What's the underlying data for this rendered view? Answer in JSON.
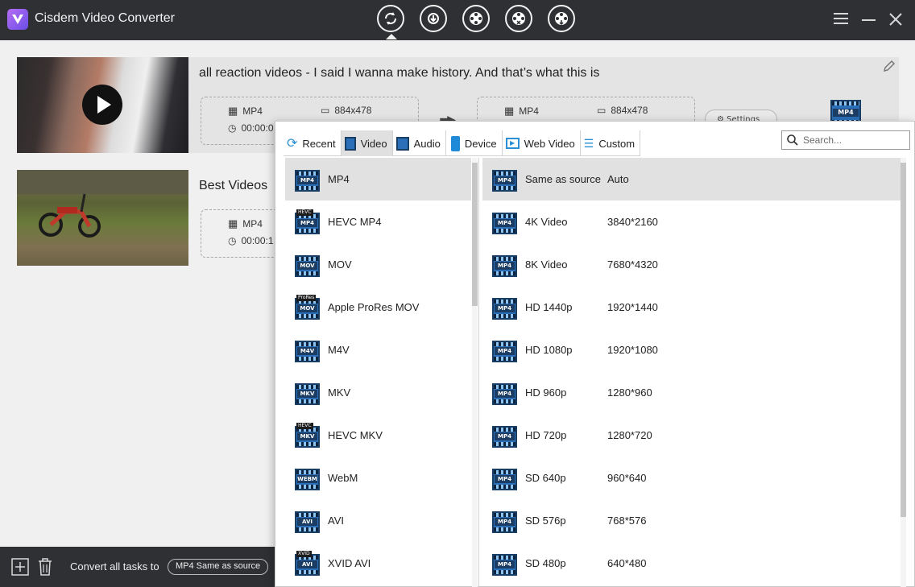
{
  "app": {
    "title": "Cisdem Video Converter"
  },
  "topnav": [
    {
      "name": "convert-tab",
      "active": true
    },
    {
      "name": "download-tab",
      "active": false
    },
    {
      "name": "burn-tab",
      "active": false
    },
    {
      "name": "rip-tab",
      "active": false
    },
    {
      "name": "compress-tab",
      "active": false
    }
  ],
  "tasks": [
    {
      "title": "all reaction videos - I said I wanna make history. And that’s what this is",
      "src_format": "MP4",
      "src_resolution": "884x478",
      "src_duration": "00:00:0",
      "dst_format": "MP4",
      "dst_resolution": "884x478",
      "settings_label": "Settings",
      "dst_badge": "MP4"
    },
    {
      "title": "Best Videos",
      "src_format": "MP4",
      "src_duration": "00:00:1"
    }
  ],
  "bottom": {
    "convert_all_label": "Convert all tasks to",
    "convert_all_value": "MP4 Same as source"
  },
  "popup": {
    "tabs": [
      {
        "label": "Recent",
        "icon": "recent-icon",
        "active": false
      },
      {
        "label": "Video",
        "icon": "video-icon",
        "active": true
      },
      {
        "label": "Audio",
        "icon": "audio-icon",
        "active": false
      },
      {
        "label": "Device",
        "icon": "device-icon",
        "active": false
      },
      {
        "label": "Web Video",
        "icon": "web-video-icon",
        "active": false
      },
      {
        "label": "Custom",
        "icon": "custom-icon",
        "active": false
      }
    ],
    "search_placeholder": "Search...",
    "formats": [
      {
        "label": "MP4",
        "badge": "MP4",
        "cap": ""
      },
      {
        "label": "HEVC MP4",
        "badge": "MP4",
        "cap": "HEVC"
      },
      {
        "label": "MOV",
        "badge": "MOV",
        "cap": ""
      },
      {
        "label": "Apple ProRes MOV",
        "badge": "MOV",
        "cap": "ProRes"
      },
      {
        "label": "M4V",
        "badge": "M4V",
        "cap": ""
      },
      {
        "label": "MKV",
        "badge": "MKV",
        "cap": ""
      },
      {
        "label": "HEVC MKV",
        "badge": "MKV",
        "cap": "HEVC"
      },
      {
        "label": "WebM",
        "badge": "WEBM",
        "cap": ""
      },
      {
        "label": "AVI",
        "badge": "AVI",
        "cap": ""
      },
      {
        "label": "XVID AVI",
        "badge": "AVI",
        "cap": "XVID"
      }
    ],
    "resolutions": [
      {
        "name": "Same as source",
        "size": "Auto"
      },
      {
        "name": "4K Video",
        "size": "3840*2160"
      },
      {
        "name": "8K Video",
        "size": "7680*4320"
      },
      {
        "name": "HD 1440p",
        "size": "1920*1440"
      },
      {
        "name": "HD 1080p",
        "size": "1920*1080"
      },
      {
        "name": "HD 960p",
        "size": "1280*960"
      },
      {
        "name": "HD 720p",
        "size": "1280*720"
      },
      {
        "name": "SD 640p",
        "size": "960*640"
      },
      {
        "name": "SD 576p",
        "size": "768*576"
      },
      {
        "name": "SD 480p",
        "size": "640*480"
      }
    ],
    "resolution_badge": "MP4"
  },
  "colors": {
    "titlebar": "#2f3034",
    "accent": "#2b6fb8",
    "selected_row": "#e1e1e1"
  }
}
